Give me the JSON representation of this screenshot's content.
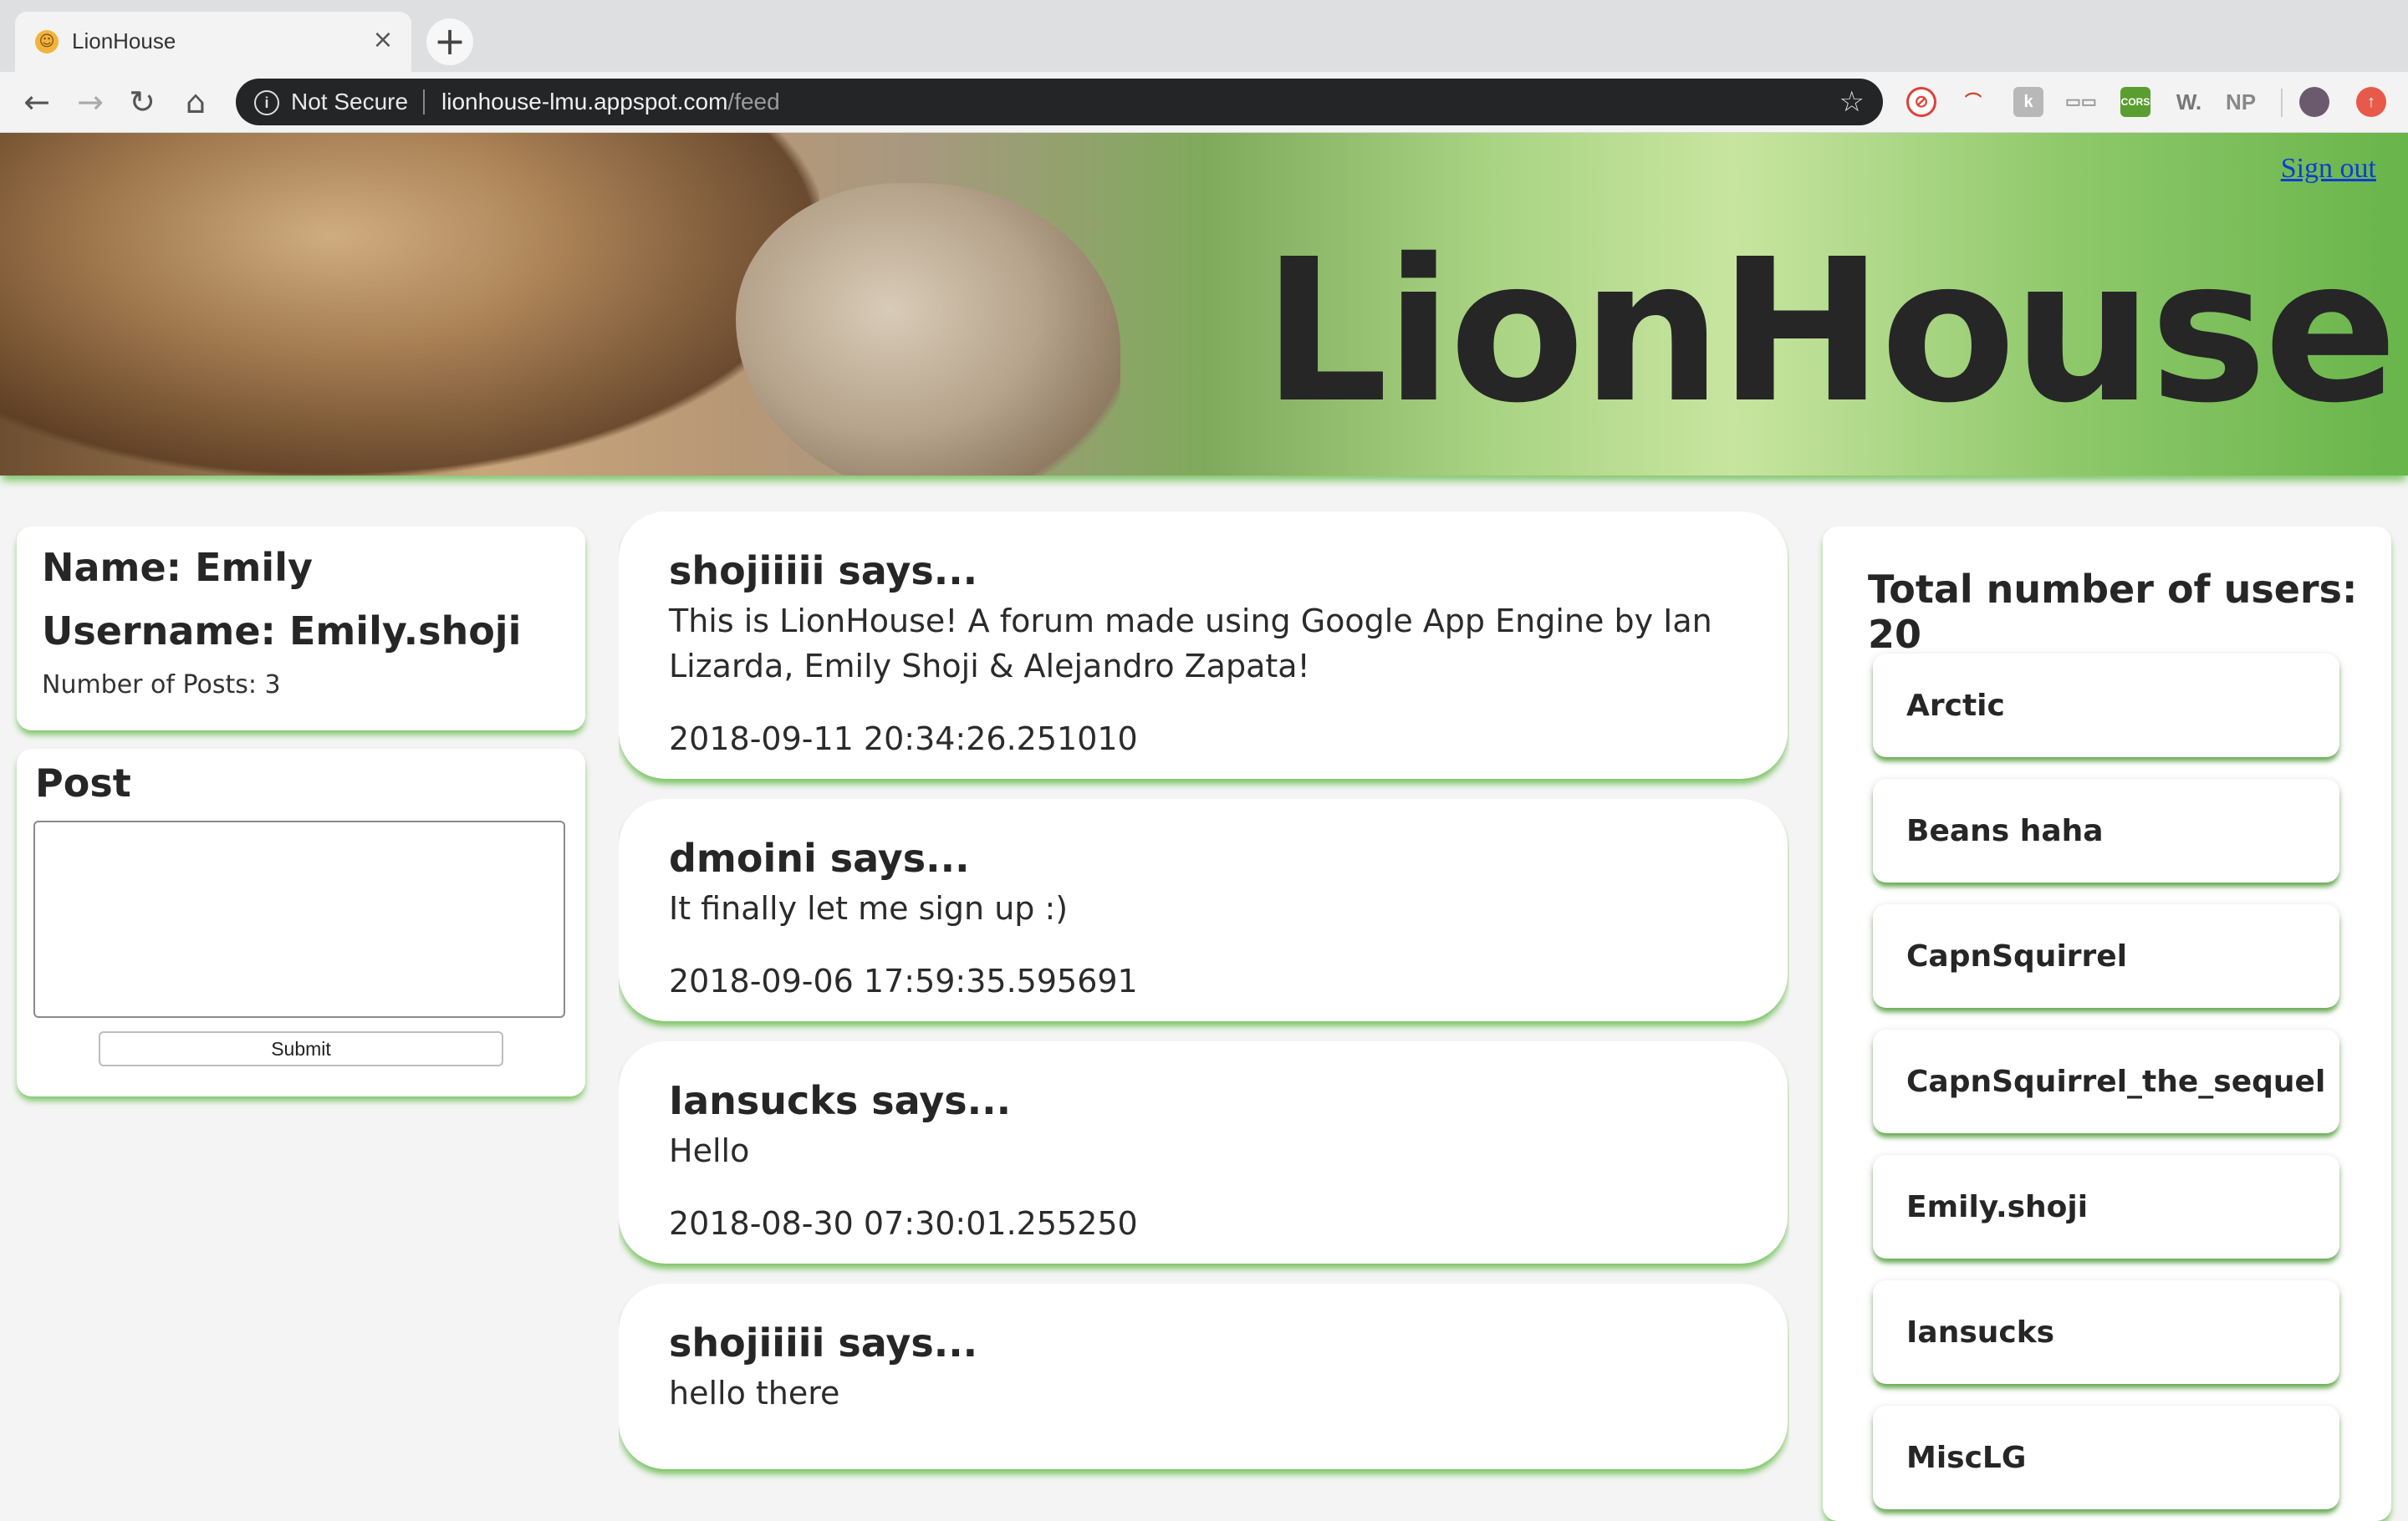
{
  "browser": {
    "tab_title": "LionHouse",
    "tab_close": "×",
    "new_tab": "+",
    "security_label": "Not Secure",
    "url_host": "lionhouse-lmu.appspot.com",
    "url_path": "/feed",
    "extensions": [
      "no-sign-icon",
      "rainbow-icon",
      "k-icon",
      "glasses-icon",
      "cors-icon",
      "w-icon",
      "np-icon",
      "profile-avatar",
      "update-icon"
    ],
    "ext_labels": {
      "cors": "CORS",
      "w": "W.",
      "np": "NP"
    }
  },
  "header": {
    "brand": "LionHouse",
    "sign_out": "Sign out"
  },
  "profile": {
    "name_line": "Name: Emily",
    "username_line": "Username: Emily.shoji",
    "posts_line": "Number of Posts: 3"
  },
  "composer": {
    "title": "Post",
    "text_value": "",
    "submit_label": "Submit"
  },
  "feed": [
    {
      "author_line": "shojiiiii says...",
      "message": "This is LionHouse! A forum made using Google App Engine by Ian Lizarda, Emily Shoji & Alejandro Zapata!",
      "timestamp": "2018-09-11 20:34:26.251010"
    },
    {
      "author_line": "dmoini says...",
      "message": "It finally let me sign up :)",
      "timestamp": "2018-09-06 17:59:35.595691"
    },
    {
      "author_line": "Iansucks says...",
      "message": "Hello",
      "timestamp": "2018-08-30 07:30:01.255250"
    },
    {
      "author_line": "shojiiiii says...",
      "message": "hello there",
      "timestamp": ""
    }
  ],
  "users": {
    "total_line": "Total number of users: 20",
    "list": [
      "Arctic",
      "Beans haha",
      "CapnSquirrel",
      "CapnSquirrel_the_sequel",
      "Emily.shoji",
      "Iansucks",
      "MiscLG"
    ]
  },
  "colors": {
    "accent_glow": "#7cc466",
    "link": "#0a3fd3",
    "omnibox": "#242527"
  }
}
